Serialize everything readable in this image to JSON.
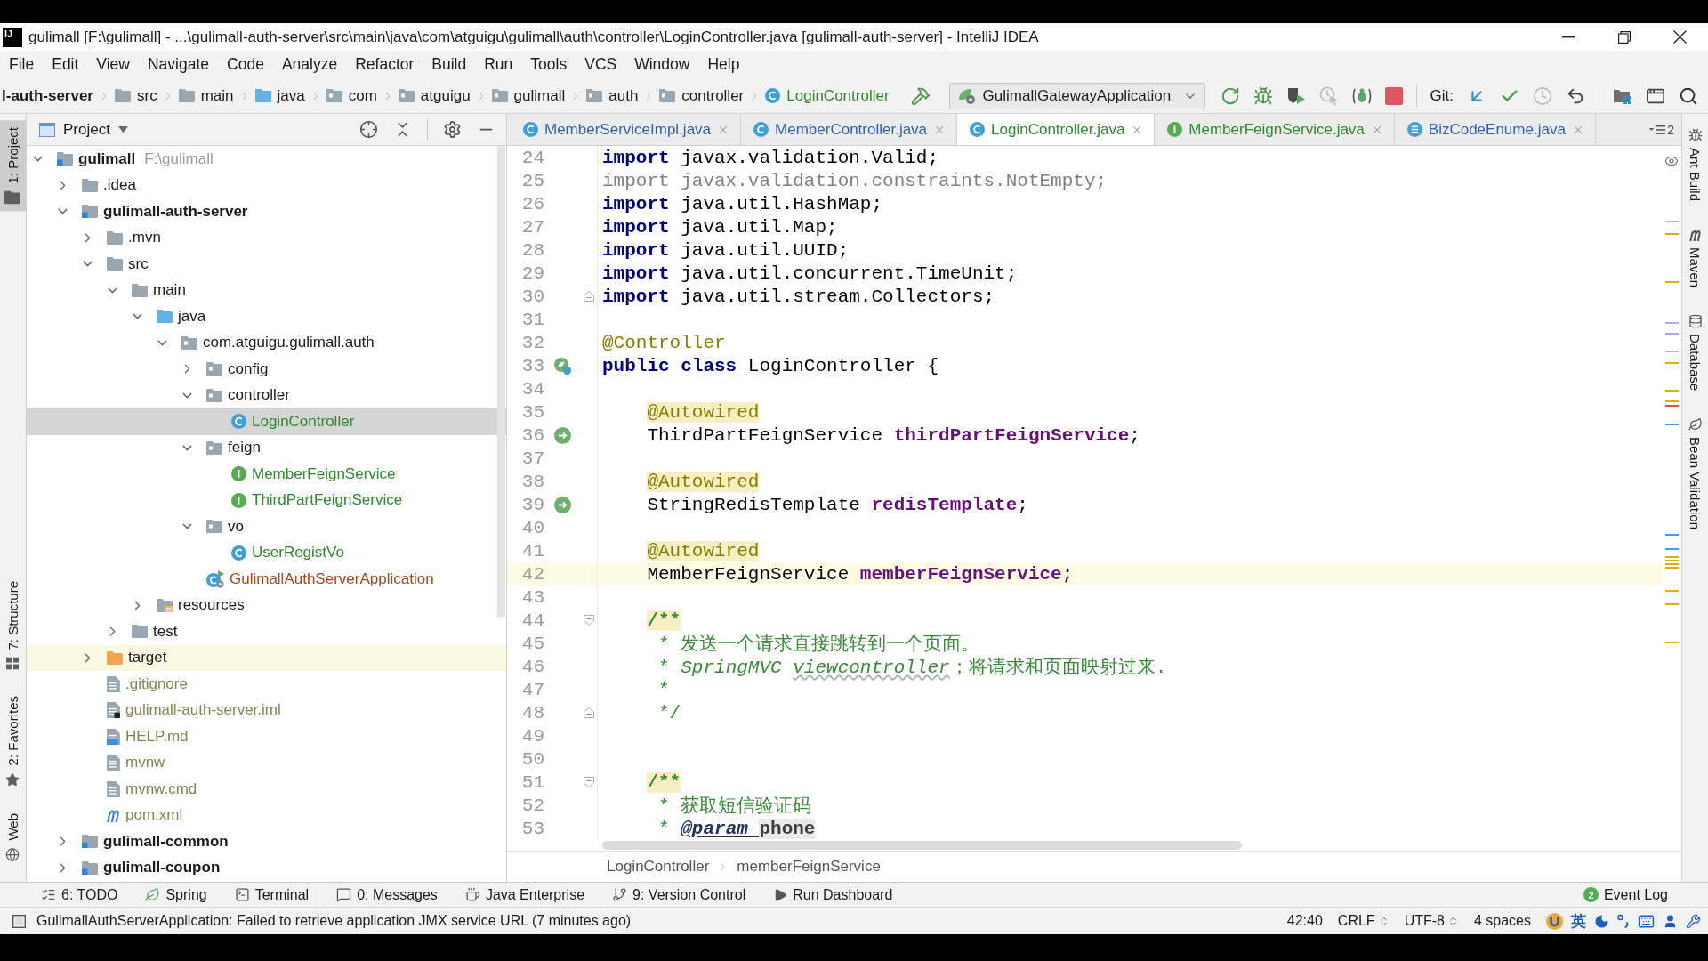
{
  "window": {
    "logo": "IJ",
    "title": "gulimall [F:\\gulimall] - ...\\gulimall-auth-server\\src\\main\\java\\com\\atguigu\\gulimall\\auth\\controller\\LoginController.java [gulimall-auth-server] - IntelliJ IDEA"
  },
  "menu": [
    "File",
    "Edit",
    "View",
    "Navigate",
    "Code",
    "Analyze",
    "Refactor",
    "Build",
    "Run",
    "Tools",
    "VCS",
    "Window",
    "Help"
  ],
  "navigation_bar": {
    "crumbs": [
      {
        "label": "l-auth-server",
        "kind": "module"
      },
      {
        "label": "src",
        "kind": "folder"
      },
      {
        "label": "main",
        "kind": "folder"
      },
      {
        "label": "java",
        "kind": "source_folder"
      },
      {
        "label": "com",
        "kind": "package"
      },
      {
        "label": "atguigu",
        "kind": "package"
      },
      {
        "label": "gulimall",
        "kind": "package"
      },
      {
        "label": "auth",
        "kind": "package"
      },
      {
        "label": "controller",
        "kind": "package"
      },
      {
        "label": "LoginController",
        "kind": "class",
        "color": "#2d8a2d"
      }
    ],
    "run_configuration": "GulimallGatewayApplication",
    "vcs_label": "Git:"
  },
  "left_stripe": {
    "top": [
      {
        "label": "1: Project",
        "kind": "project",
        "selected": true
      }
    ],
    "bottom": [
      {
        "label": "7: Structure",
        "kind": "structure",
        "selected": false
      },
      {
        "label": "2: Favorites",
        "kind": "favorites",
        "selected": false
      },
      {
        "label": "Web",
        "kind": "web",
        "selected": false
      }
    ]
  },
  "project_panel": {
    "title": "Project",
    "tree": [
      {
        "label": "gulimall",
        "kind": "module",
        "path": "F:\\gulimall",
        "expanded": true,
        "selected": false,
        "children": [
          {
            "label": ".idea",
            "kind": "folder",
            "expanded": false,
            "selected": false
          },
          {
            "label": "gulimall-auth-server",
            "kind": "module",
            "expanded": true,
            "selected": false,
            "children": [
              {
                "label": ".mvn",
                "kind": "folder",
                "expanded": false,
                "selected": false
              },
              {
                "label": "src",
                "kind": "folder",
                "expanded": true,
                "selected": false,
                "children": [
                  {
                    "label": "main",
                    "kind": "folder",
                    "expanded": true,
                    "selected": false,
                    "children": [
                      {
                        "label": "java",
                        "kind": "source_folder",
                        "expanded": true,
                        "selected": false,
                        "children": [
                          {
                            "label": "com.atguigu.gulimall.auth",
                            "kind": "package",
                            "expanded": true,
                            "selected": false,
                            "children": [
                              {
                                "label": "config",
                                "kind": "package",
                                "expanded": false,
                                "selected": false
                              },
                              {
                                "label": "controller",
                                "kind": "package",
                                "expanded": true,
                                "selected": false,
                                "children": [
                                  {
                                    "label": "LoginController",
                                    "kind": "class",
                                    "color": "#2d8a2d",
                                    "selected": true
                                  }
                                ]
                              },
                              {
                                "label": "feign",
                                "kind": "package",
                                "expanded": true,
                                "selected": false,
                                "children": [
                                  {
                                    "label": "MemberFeignService",
                                    "kind": "interface",
                                    "color": "#2d8a2d",
                                    "selected": false
                                  },
                                  {
                                    "label": "ThirdPartFeignService",
                                    "kind": "interface",
                                    "color": "#2d8a2d",
                                    "selected": false
                                  }
                                ]
                              },
                              {
                                "label": "vo",
                                "kind": "package",
                                "expanded": true,
                                "selected": false,
                                "children": [
                                  {
                                    "label": "UserRegistVo",
                                    "kind": "class",
                                    "color": "#2d8a2d",
                                    "selected": false
                                  }
                                ]
                              },
                              {
                                "label": "GulimallAuthServerApplication",
                                "kind": "boot_class",
                                "color": "#a5481e",
                                "selected": false
                              }
                            ]
                          }
                        ]
                      },
                      {
                        "label": "resources",
                        "kind": "resources_folder",
                        "expanded": false,
                        "selected": false
                      }
                    ]
                  },
                  {
                    "label": "test",
                    "kind": "folder",
                    "expanded": false,
                    "selected": false
                  }
                ]
              },
              {
                "label": "target",
                "kind": "excluded_folder",
                "expanded": false,
                "selected": false
              },
              {
                "label": ".gitignore",
                "kind": "text_file",
                "color": "#85854f",
                "selected": false
              },
              {
                "label": "gulimall-auth-server.iml",
                "kind": "iml_file",
                "color": "#85854f",
                "selected": false
              },
              {
                "label": "HELP.md",
                "kind": "markdown_file",
                "color": "#85854f",
                "selected": false
              },
              {
                "label": "mvnw",
                "kind": "text_file",
                "color": "#85854f",
                "selected": false
              },
              {
                "label": "mvnw.cmd",
                "kind": "text_file",
                "color": "#85854f",
                "selected": false
              },
              {
                "label": "pom.xml",
                "kind": "maven_file",
                "color": "#85854f",
                "selected": false
              }
            ]
          },
          {
            "label": "gulimall-common",
            "kind": "module",
            "expanded": false,
            "selected": false
          },
          {
            "label": "gulimall-coupon",
            "kind": "module",
            "expanded": false,
            "selected": false
          }
        ]
      }
    ]
  },
  "editor": {
    "tabs": [
      {
        "label": "MemberServiceImpl.java",
        "kind": "class",
        "color": "#2f5fb8",
        "selected": false
      },
      {
        "label": "MemberController.java",
        "kind": "class",
        "color": "#2f5fb8",
        "selected": false
      },
      {
        "label": "LoginController.java",
        "kind": "class",
        "color": "#2d8a2d",
        "selected": true
      },
      {
        "label": "MemberFeignService.java",
        "kind": "interface",
        "color": "#2d8a2d",
        "selected": false
      },
      {
        "label": "BizCodeEnume.java",
        "kind": "enum",
        "color": "#2f5fb8",
        "selected": false
      }
    ],
    "hidden_tabs": "2",
    "lines": [
      {
        "number": "24",
        "current": false,
        "tokens": [
          {
            "kind": "keyword",
            "text": "import"
          },
          {
            "kind": "plain",
            "text": " javax.validation.Valid;"
          }
        ]
      },
      {
        "number": "25",
        "current": false,
        "tokens": [
          {
            "kind": "unused",
            "text": "import javax.validation.constraints.NotEmpty;"
          }
        ]
      },
      {
        "number": "26",
        "current": false,
        "tokens": [
          {
            "kind": "keyword",
            "text": "import"
          },
          {
            "kind": "plain",
            "text": " java.util.HashMap;"
          }
        ]
      },
      {
        "number": "27",
        "current": false,
        "tokens": [
          {
            "kind": "keyword",
            "text": "import"
          },
          {
            "kind": "plain",
            "text": " java.util.Map;"
          }
        ]
      },
      {
        "number": "28",
        "current": false,
        "tokens": [
          {
            "kind": "keyword",
            "text": "import"
          },
          {
            "kind": "plain",
            "text": " java.util.UUID;"
          }
        ]
      },
      {
        "number": "29",
        "current": false,
        "tokens": [
          {
            "kind": "keyword",
            "text": "import"
          },
          {
            "kind": "plain",
            "text": " java.util.concurrent.TimeUnit;"
          }
        ]
      },
      {
        "number": "30",
        "current": false,
        "fold": {
          "kind": "end"
        },
        "tokens": [
          {
            "kind": "keyword",
            "text": "import"
          },
          {
            "kind": "plain",
            "text": " java.util.stream.Collectors;"
          }
        ]
      },
      {
        "number": "31",
        "current": false
      },
      {
        "number": "32",
        "current": false,
        "tokens": [
          {
            "kind": "annotation",
            "text": "@Controller"
          }
        ]
      },
      {
        "number": "33",
        "current": false,
        "gutter": {
          "kind": "bean"
        },
        "tokens": [
          {
            "kind": "keyword",
            "text": "public class"
          },
          {
            "kind": "plain",
            "text": " LoginController {"
          }
        ]
      },
      {
        "number": "34",
        "current": false
      },
      {
        "number": "35",
        "current": false,
        "indented": true,
        "tokens": [
          {
            "kind": "annotation_flagged",
            "text": "@Autowired"
          }
        ]
      },
      {
        "number": "36",
        "current": false,
        "indented": true,
        "gutter": {
          "kind": "autowire"
        },
        "tokens": [
          {
            "kind": "plain",
            "text": "ThirdPartFeignService "
          },
          {
            "kind": "field",
            "text": "thirdPartFeignService"
          },
          {
            "kind": "plain",
            "text": ";"
          }
        ]
      },
      {
        "number": "37",
        "current": false
      },
      {
        "number": "38",
        "current": false,
        "indented": true,
        "tokens": [
          {
            "kind": "annotation_flagged",
            "text": "@Autowired"
          }
        ]
      },
      {
        "number": "39",
        "current": false,
        "indented": true,
        "gutter": {
          "kind": "autowire"
        },
        "tokens": [
          {
            "kind": "plain",
            "text": "StringRedisTemplate "
          },
          {
            "kind": "field",
            "text": "redisTemplate"
          },
          {
            "kind": "plain",
            "text": ";"
          }
        ]
      },
      {
        "number": "40",
        "current": false
      },
      {
        "number": "41",
        "current": false,
        "indented": true,
        "tokens": [
          {
            "kind": "annotation_flagged",
            "text": "@Autowired"
          }
        ]
      },
      {
        "number": "42",
        "current": true,
        "indented": true,
        "tokens": [
          {
            "kind": "plain",
            "text": "MemberFeignService "
          },
          {
            "kind": "field",
            "text": "memberFeignService"
          },
          {
            "kind": "plain",
            "text": ";"
          }
        ]
      },
      {
        "number": "43",
        "current": false
      },
      {
        "number": "44",
        "current": false,
        "indented": true,
        "fold": {
          "kind": "start"
        },
        "tokens": [
          {
            "kind": "doc_flagged",
            "text": "/**"
          }
        ]
      },
      {
        "number": "45",
        "current": false,
        "indented": true,
        "tokens": [
          {
            "kind": "doc",
            "text": " * 发送一个请求直接跳转到一个页面。"
          }
        ]
      },
      {
        "number": "46",
        "current": false,
        "indented": true,
        "tokens": [
          {
            "kind": "doc",
            "text": " * "
          },
          {
            "kind": "doc_code",
            "text": "SpringMVC "
          },
          {
            "kind": "doc_typo",
            "text": "viewcontroller"
          },
          {
            "kind": "doc",
            "text": "；将请求和页面映射过来."
          }
        ]
      },
      {
        "number": "47",
        "current": false,
        "indented": true,
        "tokens": [
          {
            "kind": "doc",
            "text": " *"
          }
        ]
      },
      {
        "number": "48",
        "current": false,
        "indented": true,
        "fold": {
          "kind": "end"
        },
        "tokens": [
          {
            "kind": "doc",
            "text": " */"
          }
        ]
      },
      {
        "number": "49",
        "current": false
      },
      {
        "number": "50",
        "current": false
      },
      {
        "number": "51",
        "current": false,
        "indented": true,
        "fold": {
          "kind": "start"
        },
        "tokens": [
          {
            "kind": "doc_flagged",
            "text": "/**"
          }
        ]
      },
      {
        "number": "52",
        "current": false,
        "indented": true,
        "tokens": [
          {
            "kind": "doc",
            "text": " * 获取短信验证码"
          }
        ]
      },
      {
        "number": "53",
        "current": false,
        "indented": true,
        "tokens": [
          {
            "kind": "doc",
            "text": " * "
          },
          {
            "kind": "doc_tag",
            "text": "@param "
          },
          {
            "kind": "doc_param",
            "text": "phone"
          }
        ]
      }
    ],
    "breadcrumb": [
      "LoginController",
      "memberFeignService"
    ]
  },
  "right_stripe": [
    {
      "label": "Ant Build",
      "kind": "ant"
    },
    {
      "label": "Maven",
      "kind": "maven"
    },
    {
      "label": "Database",
      "kind": "database"
    },
    {
      "label": "Bean Validation",
      "kind": "bean_validation"
    }
  ],
  "tool_window_bar": {
    "items": [
      {
        "label": "6: TODO",
        "kind": "todo"
      },
      {
        "label": "Spring",
        "kind": "spring"
      },
      {
        "label": "Terminal",
        "kind": "terminal"
      },
      {
        "label": "0: Messages",
        "kind": "messages"
      },
      {
        "label": "Java Enterprise",
        "kind": "java_ee"
      },
      {
        "label": "9: Version Control",
        "kind": "vcs"
      },
      {
        "label": "Run Dashboard",
        "kind": "run"
      }
    ],
    "event_log": {
      "label": "Event Log",
      "count": "2"
    }
  },
  "status_bar": {
    "message": "GulimallAuthServerApplication: Failed to retrieve application JMX service URL (7 minutes ago)",
    "caret_position": "42:40",
    "line_separator": "CRLF",
    "encoding": "UTF-8",
    "indent": "4 spaces",
    "input_mode": "英"
  }
}
